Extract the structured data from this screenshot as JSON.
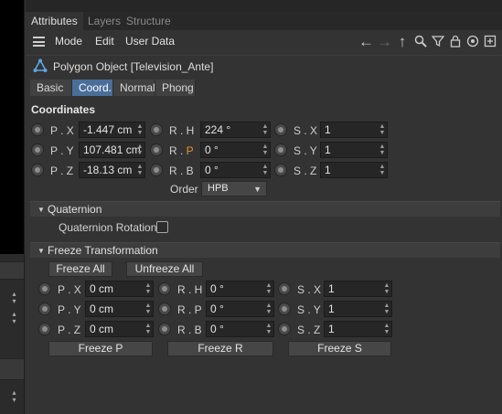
{
  "tabs": [
    "Attributes",
    "Layers",
    "Structure"
  ],
  "menu": [
    "Mode",
    "Edit",
    "User Data"
  ],
  "toolbar_icons": [
    "arrow-left-icon",
    "arrow-right-icon",
    "arrow-up-icon",
    "search-icon",
    "filter-icon",
    "lock-icon",
    "target-icon",
    "add-panel-icon"
  ],
  "object_title": "Polygon Object [Television_Ante]",
  "subtabs": [
    "Basic",
    "Coord.",
    "Normal",
    "Phong"
  ],
  "active_subtab": "Coord.",
  "section_title": "Coordinates",
  "coords": {
    "p": [
      {
        "label": "P . X",
        "value": "-1.447 cm"
      },
      {
        "label": "P . Y",
        "value": "107.481 cm"
      },
      {
        "label": "P . Z",
        "value": "-18.13 cm"
      }
    ],
    "r": [
      {
        "label": "R . H",
        "value": "224 °"
      },
      {
        "label": "R . ",
        "label_accent": "P",
        "value": "0 °"
      },
      {
        "label": "R . B",
        "value": "0 °"
      }
    ],
    "s": [
      {
        "label": "S . X",
        "value": "1"
      },
      {
        "label": "S . Y",
        "value": "1"
      },
      {
        "label": "S . Z",
        "value": "1"
      }
    ]
  },
  "order": {
    "label": "Order",
    "value": "HPB"
  },
  "quaternion": {
    "header": "Quaternion",
    "checkbox_label": "Quaternion Rotation",
    "checked": false
  },
  "freeze": {
    "header": "Freeze Transformation",
    "freeze_all": "Freeze All",
    "unfreeze_all": "Unfreeze All",
    "p": [
      {
        "label": "P . X",
        "value": "0 cm"
      },
      {
        "label": "P . Y",
        "value": "0 cm"
      },
      {
        "label": "P . Z",
        "value": "0 cm"
      }
    ],
    "r": [
      {
        "label": "R . H",
        "value": "0 °"
      },
      {
        "label": "R . P",
        "value": "0 °"
      },
      {
        "label": "R . B",
        "value": "0 °"
      }
    ],
    "s": [
      {
        "label": "S . X",
        "value": "1"
      },
      {
        "label": "S . Y",
        "value": "1"
      },
      {
        "label": "S . Z",
        "value": "1"
      }
    ],
    "freeze_p": "Freeze P",
    "freeze_r": "Freeze R",
    "freeze_s": "Freeze S"
  },
  "colors": {
    "accent_blue": "#4a6e9a",
    "label_orange": "#e0932a",
    "field_bg": "#262626",
    "panel_bg": "#333333"
  }
}
